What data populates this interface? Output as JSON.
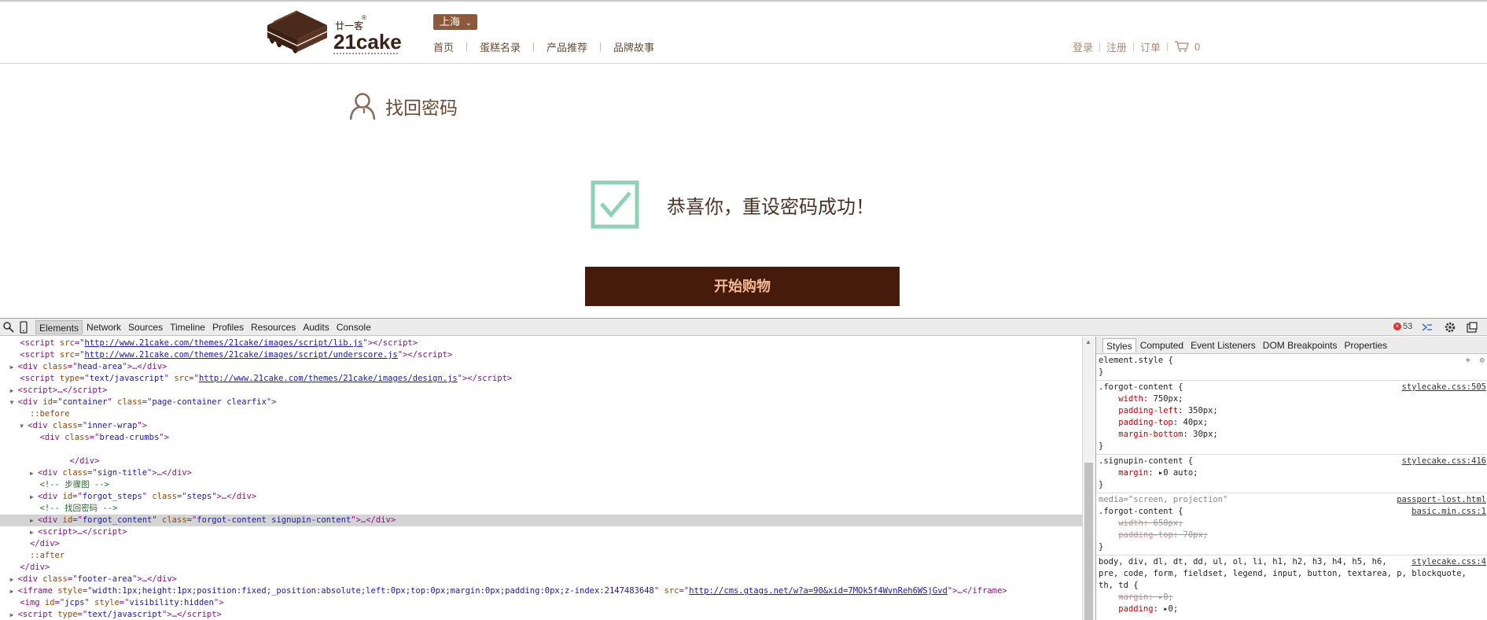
{
  "header": {
    "logo_cn": "廿一客",
    "logo_en": "21cake",
    "city": "上海",
    "nav": [
      "首页",
      "蛋糕名录",
      "产品推荐",
      "品牌故事"
    ],
    "user_nav": [
      "登录",
      "注册",
      "订单"
    ],
    "cart_count": "0"
  },
  "content": {
    "title": "找回密码",
    "success_message": "恭喜你，重设密码成功！",
    "start_button": "开始购物"
  },
  "colors": {
    "brand_brown": "#461b0c",
    "city_btn": "#8b5a3c",
    "success_green": "#8fd1b5"
  },
  "devtools": {
    "tabs": [
      "Elements",
      "Network",
      "Sources",
      "Timeline",
      "Profiles",
      "Resources",
      "Audits",
      "Console"
    ],
    "active_tab": "Elements",
    "error_count": "53",
    "elements": {
      "l1_src": "http://www.21cake.com/themes/21cake/images/script/lib.js",
      "l2_src": "http://www.21cake.com/themes/21cake/images/script/underscore.js",
      "l3_class": "head-area",
      "l4_src": "http://www.21cake.com/themes/21cake/images/design.js",
      "l6_id": "container",
      "l6_class": "page-container clearfix",
      "l7": "::before",
      "l8_class": "inner-wrap",
      "l9_class": "bread-crumbs",
      "l11_class": "sign-title",
      "l12": "<!-- 步骤图 -->",
      "l13_id": "forgot_steps",
      "l13_class": "steps",
      "l14": "<!-- 找回密码 -->",
      "l15_id": "forgot_content",
      "l15_class": "forgot-content signupin-content",
      "l18": "::after",
      "l20_class": "footer-area",
      "l21_style": "width:1px;height:1px;position:fixed;_position:absolute;left:0px;top:0px;margin:0px;padding:0px;z-index:2147483648",
      "l21_src": "http://cms.gtags.net/w?a=90&xid=7MOk5f4WvnReh6WSjGvd",
      "l22_id": "jcps",
      "l22_style": "visibility:hidden",
      "l23_type": "text/javascript"
    },
    "styles": {
      "tabs": [
        "Styles",
        "Computed",
        "Event Listeners",
        "DOM Breakpoints",
        "Properties"
      ],
      "active_tab": "Styles",
      "element_style": "element.style {",
      "r1_selector": ".forgot-content {",
      "r1_src": "stylecake.css:505",
      "r1_props": [
        {
          "name": "width",
          "value": "750px;"
        },
        {
          "name": "padding-left",
          "value": "350px;"
        },
        {
          "name": "padding-top",
          "value": "40px;"
        },
        {
          "name": "margin-bottom",
          "value": "30px;"
        }
      ],
      "r2_selector": ".signupin-content {",
      "r2_src": "stylecake.css:416",
      "r2_prop_name": "margin",
      "r2_prop_value": "0 auto;",
      "r3_media": "media=\"screen, projection\"",
      "r3_media_src": "passport-lost.html",
      "r3_selector": ".forgot-content {",
      "r3_src": "basic.min.css:1",
      "r3_props": [
        {
          "name": "width",
          "value": "650px;"
        },
        {
          "name": "padding-top",
          "value": "70px;"
        }
      ],
      "r4_selector_1": "body, div, dl, dt, dd, ul, ol, li, h1, h2, h3, h4, h5, h6,",
      "r4_selector_2": "pre, code, form, fieldset, legend, input, button, textarea, p, blockquote,",
      "r4_selector_3": "th, td {",
      "r4_src": "stylecake.css:4",
      "r4_prop1_name": "margin",
      "r4_prop1_value": "0;",
      "r4_prop2_name": "padding",
      "r4_prop2_value": "0;"
    }
  }
}
